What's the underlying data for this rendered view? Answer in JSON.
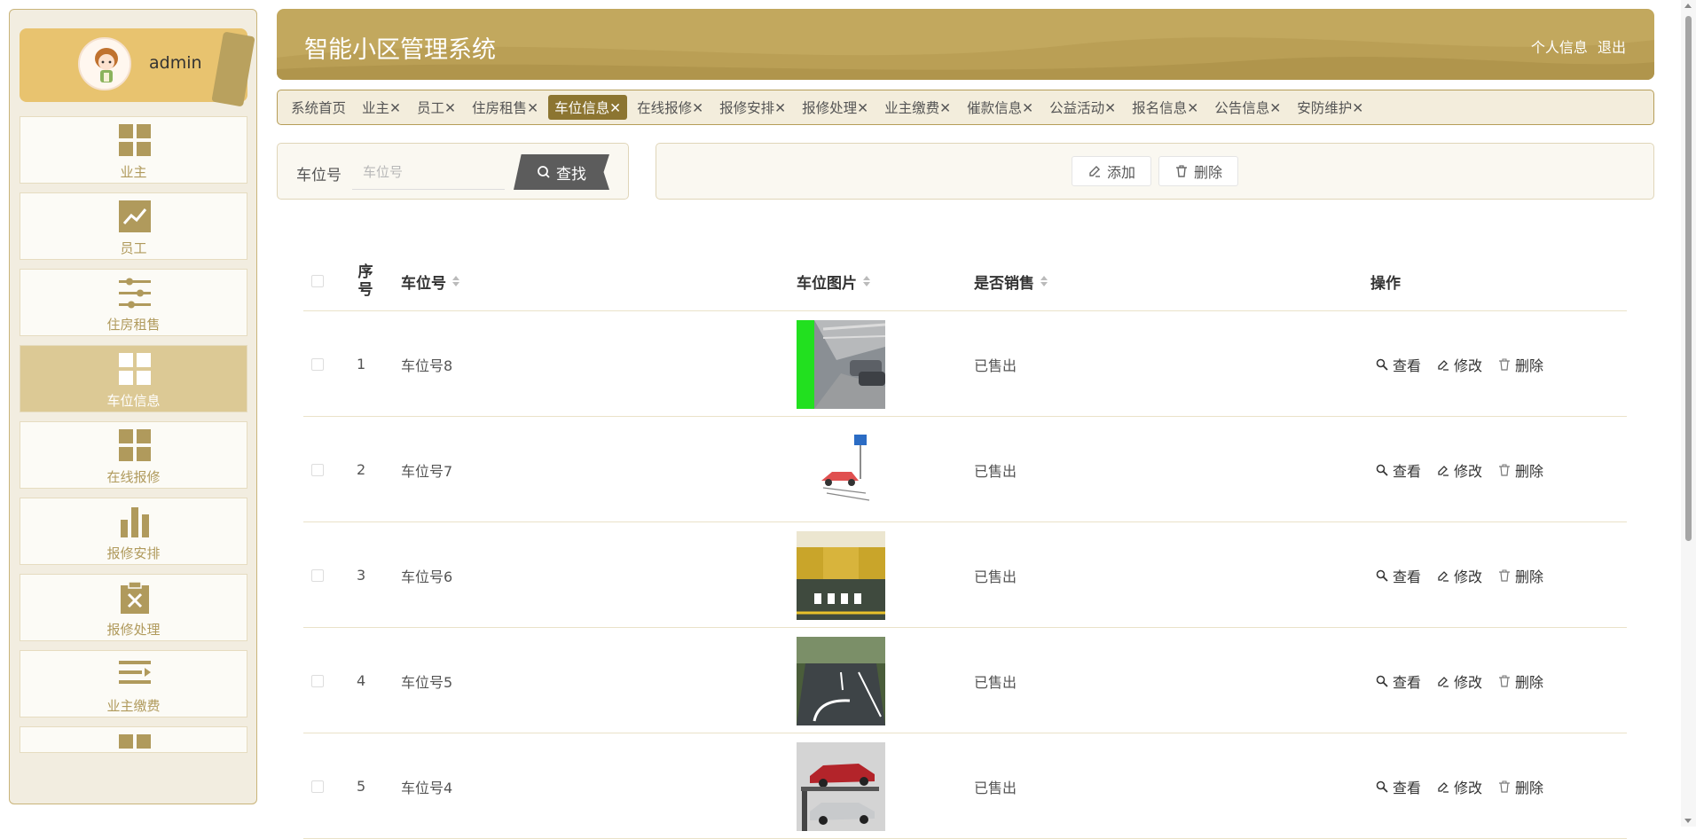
{
  "sidebar": {
    "username": "admin",
    "items": [
      {
        "label": "业主",
        "icon": "grid-icon",
        "active": false
      },
      {
        "label": "员工",
        "icon": "trend-chart-icon",
        "active": false
      },
      {
        "label": "住房租售",
        "icon": "sliders-icon",
        "active": false
      },
      {
        "label": "车位信息",
        "icon": "grid-icon",
        "active": true
      },
      {
        "label": "在线报修",
        "icon": "grid-icon",
        "active": false
      },
      {
        "label": "报修安排",
        "icon": "bar-chart-icon",
        "active": false
      },
      {
        "label": "报修处理",
        "icon": "clipboard-x-icon",
        "active": false
      },
      {
        "label": "业主缴费",
        "icon": "list-icon",
        "active": false
      },
      {
        "label": "",
        "icon": "grid-icon",
        "active": false
      }
    ]
  },
  "header": {
    "title": "智能小区管理系统",
    "profile_link": "个人信息",
    "logout_link": "退出"
  },
  "tabs": [
    {
      "label": "系统首页",
      "closable": false,
      "active": false
    },
    {
      "label": "业主",
      "closable": true,
      "active": false
    },
    {
      "label": "员工",
      "closable": true,
      "active": false
    },
    {
      "label": "住房租售",
      "closable": true,
      "active": false
    },
    {
      "label": "车位信息",
      "closable": true,
      "active": true
    },
    {
      "label": "在线报修",
      "closable": true,
      "active": false
    },
    {
      "label": "报修安排",
      "closable": true,
      "active": false
    },
    {
      "label": "报修处理",
      "closable": true,
      "active": false
    },
    {
      "label": "业主缴费",
      "closable": true,
      "active": false
    },
    {
      "label": "催款信息",
      "closable": true,
      "active": false
    },
    {
      "label": "公益活动",
      "closable": true,
      "active": false
    },
    {
      "label": "报名信息",
      "closable": true,
      "active": false
    },
    {
      "label": "公告信息",
      "closable": true,
      "active": false
    },
    {
      "label": "安防维护",
      "closable": true,
      "active": false
    }
  ],
  "search": {
    "label": "车位号",
    "value": "",
    "placeholder": "车位号",
    "button": "查找"
  },
  "actions": {
    "add": "添加",
    "delete": "删除"
  },
  "table": {
    "headers": {
      "index": "序号",
      "space_no": "车位号",
      "image": "车位图片",
      "sold": "是否销售",
      "ops": "操作"
    },
    "op_labels": {
      "view": "查看",
      "edit": "修改",
      "delete": "删除"
    },
    "rows": [
      {
        "index": "1",
        "space_no": "车位号8",
        "image": "underground-garage-photo",
        "sold": "已售出"
      },
      {
        "index": "2",
        "space_no": "车位号7",
        "image": "parking-cartoon",
        "sold": "已售出"
      },
      {
        "index": "3",
        "space_no": "车位号6",
        "image": "yellow-garage-photo",
        "sold": "已售出"
      },
      {
        "index": "4",
        "space_no": "车位号5",
        "image": "outdoor-parking-photo",
        "sold": "已售出"
      },
      {
        "index": "5",
        "space_no": "车位号4",
        "image": "stacked-parking-photo",
        "sold": "已售出"
      }
    ]
  },
  "colors": {
    "brand": "#c2a85e",
    "active_tab": "#8c7531",
    "active_menu": "#dcc995"
  }
}
